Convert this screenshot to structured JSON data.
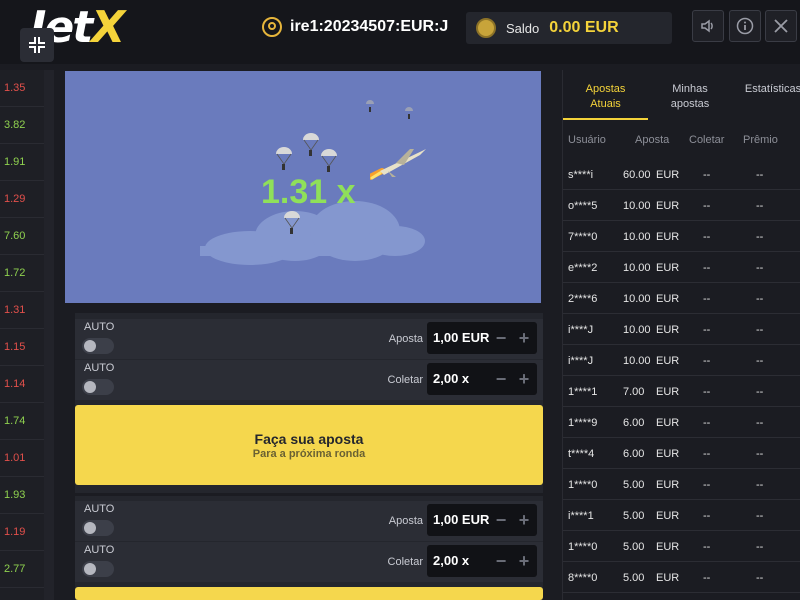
{
  "header": {
    "logo_main": "Jet",
    "logo_accent": "X",
    "username": "ire1:20234507:EUR:J",
    "balance_label": "Saldo",
    "balance_value": "0.00 EUR"
  },
  "history": [
    {
      "value": "1.35",
      "color": "red"
    },
    {
      "value": "3.82",
      "color": "green"
    },
    {
      "value": "1.91",
      "color": "green"
    },
    {
      "value": "1.29",
      "color": "red"
    },
    {
      "value": "7.60",
      "color": "green"
    },
    {
      "value": "1.72",
      "color": "green"
    },
    {
      "value": "1.31",
      "color": "red"
    },
    {
      "value": "1.15",
      "color": "red"
    },
    {
      "value": "1.14",
      "color": "red"
    },
    {
      "value": "1.74",
      "color": "green"
    },
    {
      "value": "1.01",
      "color": "red"
    },
    {
      "value": "1.93",
      "color": "green"
    },
    {
      "value": "1.19",
      "color": "red"
    },
    {
      "value": "2.77",
      "color": "green"
    }
  ],
  "game": {
    "multiplier": "1.31 x"
  },
  "bet_panels": [
    {
      "bet": {
        "auto": "AUTO",
        "label": "Aposta",
        "value": "1,00 EUR"
      },
      "cashout": {
        "auto": "AUTO",
        "label": "Coletar",
        "value": "2,00 x"
      },
      "button_title": "Faça sua aposta",
      "button_sub": "Para a próxima ronda"
    },
    {
      "bet": {
        "auto": "AUTO",
        "label": "Aposta",
        "value": "1,00 EUR"
      },
      "cashout": {
        "auto": "AUTO",
        "label": "Coletar",
        "value": "2,00 x"
      }
    }
  ],
  "right_panel": {
    "tabs": [
      {
        "label": "Apostas Atuais",
        "active": true
      },
      {
        "label": "Minhas apostas",
        "active": false
      },
      {
        "label": "Estatísticas",
        "active": false
      }
    ],
    "columns": [
      "Usuário",
      "Aposta",
      "Coletar",
      "Prêmio"
    ],
    "rows": [
      {
        "user": "s****i",
        "bet": "60.00",
        "currency": "EUR",
        "cashout": "--",
        "prize": "--"
      },
      {
        "user": "o****5",
        "bet": "10.00",
        "currency": "EUR",
        "cashout": "--",
        "prize": "--"
      },
      {
        "user": "7****0",
        "bet": "10.00",
        "currency": "EUR",
        "cashout": "--",
        "prize": "--"
      },
      {
        "user": "e****2",
        "bet": "10.00",
        "currency": "EUR",
        "cashout": "--",
        "prize": "--"
      },
      {
        "user": "2****6",
        "bet": "10.00",
        "currency": "EUR",
        "cashout": "--",
        "prize": "--"
      },
      {
        "user": "i****J",
        "bet": "10.00",
        "currency": "EUR",
        "cashout": "--",
        "prize": "--"
      },
      {
        "user": "i****J",
        "bet": "10.00",
        "currency": "EUR",
        "cashout": "--",
        "prize": "--"
      },
      {
        "user": "1****1",
        "bet": "7.00",
        "currency": "EUR",
        "cashout": "--",
        "prize": "--"
      },
      {
        "user": "1****9",
        "bet": "6.00",
        "currency": "EUR",
        "cashout": "--",
        "prize": "--"
      },
      {
        "user": "t****4",
        "bet": "6.00",
        "currency": "EUR",
        "cashout": "--",
        "prize": "--"
      },
      {
        "user": "1****0",
        "bet": "5.00",
        "currency": "EUR",
        "cashout": "--",
        "prize": "--"
      },
      {
        "user": "i****1",
        "bet": "5.00",
        "currency": "EUR",
        "cashout": "--",
        "prize": "--"
      },
      {
        "user": "1****0",
        "bet": "5.00",
        "currency": "EUR",
        "cashout": "--",
        "prize": "--"
      },
      {
        "user": "8****0",
        "bet": "5.00",
        "currency": "EUR",
        "cashout": "--",
        "prize": "--"
      }
    ]
  },
  "icons": {
    "collapse": "collapse-icon",
    "user": "user-icon",
    "coins": "coins-icon",
    "sound": "sound-icon",
    "info": "info-icon",
    "close": "close-icon",
    "plane": "plane-icon",
    "parachute": "parachute-icon"
  },
  "colors": {
    "accent_yellow": "#f4d33a",
    "loss_red": "#e2504b",
    "win_green": "#8fd14f",
    "game_bg": "#6a7bbd",
    "multiplier": "#8fe05a"
  }
}
